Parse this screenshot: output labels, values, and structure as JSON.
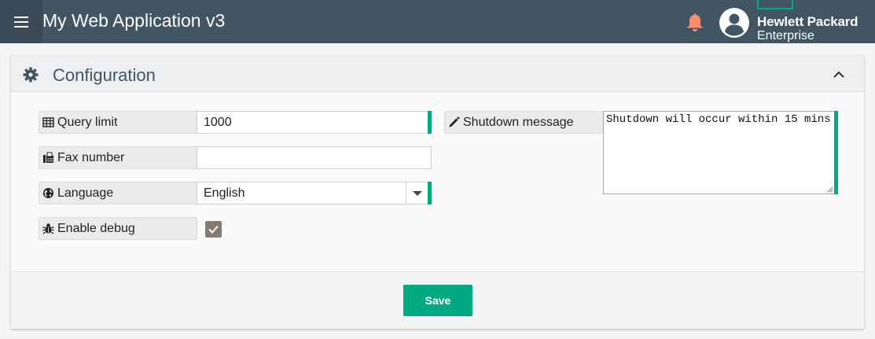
{
  "header": {
    "title": "My Web Application v3",
    "menu_icon": "hamburger-icon",
    "notification_icon": "bell-icon",
    "avatar_icon": "user-avatar-icon",
    "brand_line1": "Hewlett Packard",
    "brand_line2": "Enterprise",
    "colors": {
      "bar": "#425563",
      "bell": "#ff8d6d",
      "brand_accent": "#01a982"
    }
  },
  "card": {
    "title": "Configuration",
    "header_icon": "gear-icon",
    "collapse_icon": "chevron-up-icon"
  },
  "form": {
    "query_limit": {
      "label": "Query limit",
      "icon": "table-icon",
      "value": "1000"
    },
    "fax_number": {
      "label": "Fax number",
      "icon": "fax-icon",
      "value": ""
    },
    "language": {
      "label": "Language",
      "icon": "globe-icon",
      "value": "English"
    },
    "enable_debug": {
      "label": "Enable debug",
      "icon": "bug-icon",
      "checked": true
    },
    "shutdown_message": {
      "label": "Shutdown message",
      "icon": "pencil-icon",
      "value": "Shutdown will occur within 15 mins"
    }
  },
  "footer": {
    "save_label": "Save"
  },
  "accent": "#01a982"
}
